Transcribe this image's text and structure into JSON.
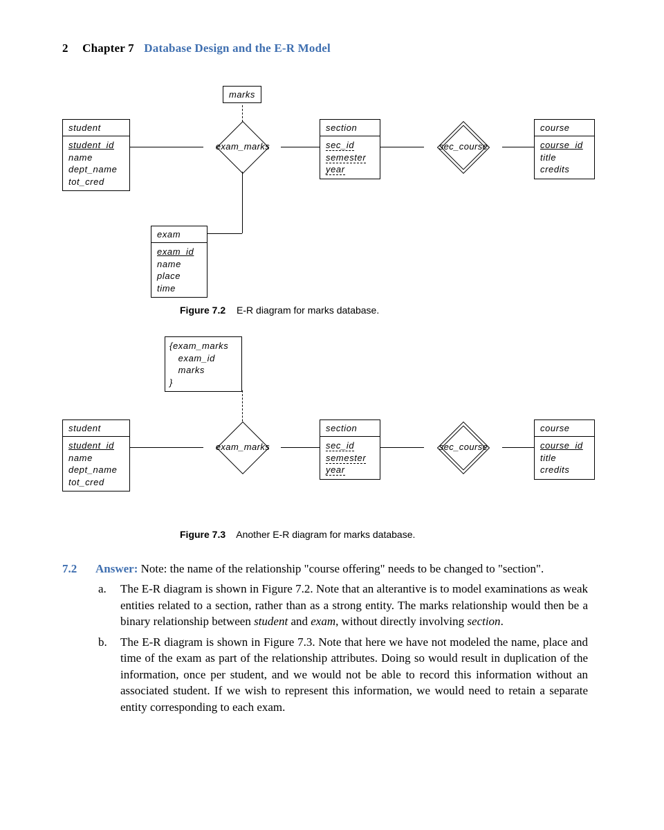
{
  "header": {
    "pageno": "2",
    "chapter": "Chapter 7",
    "title": "Database Design and the E-R Model"
  },
  "fig1": {
    "assoc_label": "marks",
    "student": {
      "title": "student",
      "attrs": [
        "student_id",
        "name",
        "dept_name",
        "tot_cred"
      ],
      "pk": [
        0
      ]
    },
    "section": {
      "title": "section",
      "attrs": [
        "sec_id",
        "semester",
        "year"
      ],
      "dash_all": true
    },
    "course": {
      "title": "course",
      "attrs": [
        "course_id",
        "title",
        "credits"
      ],
      "pk": [
        0
      ]
    },
    "exam": {
      "title": "exam",
      "attrs": [
        "exam_id",
        "name",
        "place",
        "time"
      ],
      "pk": [
        0
      ]
    },
    "rel1": "exam_marks",
    "rel2": "sec_course",
    "caption_label": "Figure 7.2",
    "caption_text": "E-R diagram for marks database."
  },
  "fig2": {
    "assoc_lines": [
      "{exam_marks",
      "   exam_id",
      "   marks",
      "}"
    ],
    "student": {
      "title": "student",
      "attrs": [
        "student_id",
        "name",
        "dept_name",
        "tot_cred"
      ],
      "pk": [
        0
      ]
    },
    "section": {
      "title": "section",
      "attrs": [
        "sec_id",
        "semester",
        "year"
      ],
      "dash_all": true
    },
    "course": {
      "title": "course",
      "attrs": [
        "course_id",
        "title",
        "credits"
      ],
      "pk": [
        0
      ]
    },
    "rel1": "exam_marks",
    "rel2": "sec_course",
    "caption_label": "Figure 7.3",
    "caption_text": "Another E-R diagram for marks database."
  },
  "answer": {
    "qnum": "7.2",
    "label": "Answer:",
    "lead": "Note: the name of the relationship \"course offering\" needs to be changed to \"section\".",
    "a": "The E-R diagram is shown in Figure 7.2. Note that an alterantive is to model examinations as weak entities related to a section, rather than as a strong entity. The marks relationship would then be a binary relationship between student and exam, without directly involving section.",
    "b": "The E-R diagram is shown in Figure 7.3. Note that here we have not modeled the name, place and time of the exam as part of the relationship attributes. Doing so would result in duplication of the information, once per student, and we would not be able to record this information without an associated student. If we wish to represent this information, we would need to retain a separate entity corresponding to each exam."
  }
}
